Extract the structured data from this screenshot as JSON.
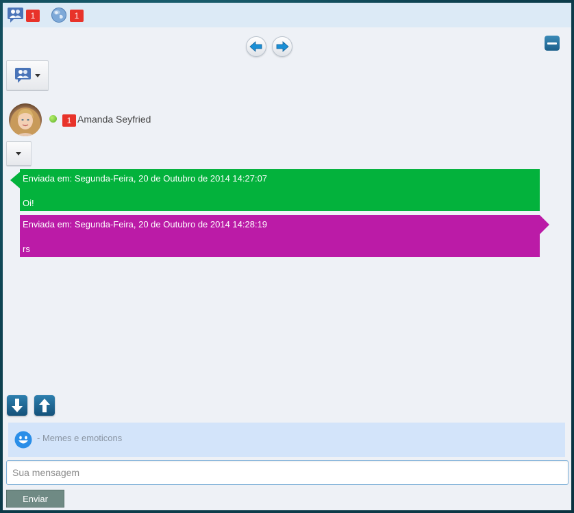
{
  "topbar": {
    "contacts_icon": "users-chat-icon",
    "contacts_count": "1",
    "global_icon": "globe-icon",
    "global_count": "1"
  },
  "navigation": {
    "prev_icon": "arrow-left-icon",
    "next_icon": "arrow-right-icon",
    "minimize_icon": "minimize-icon"
  },
  "contacts_menu": {
    "icon": "users-chat-icon",
    "caret": "caret-down-icon"
  },
  "contact": {
    "name": "Amanda Seyfried",
    "status": "online",
    "unread_count": "1"
  },
  "messages": [
    {
      "meta": "Enviada em: Segunda-Feira, 20 de Outubro de 2014 14:27:07",
      "text": "Oi!",
      "color": "#03b23c",
      "direction": "incoming"
    },
    {
      "meta": "Enviada em: Segunda-Feira, 20 de Outubro de 2014 14:28:19",
      "text": "rs",
      "color": "#bb1ba7",
      "direction": "outgoing"
    }
  ],
  "scroll": {
    "down_icon": "arrow-down-icon",
    "up_icon": "arrow-up-icon"
  },
  "emoticons": {
    "icon": "smiley-icon",
    "label": "- Memes e emoticons"
  },
  "composer": {
    "placeholder": "Sua mensagem",
    "value": "",
    "send_label": "Enviar"
  },
  "colors": {
    "accent": "#1b5f8a",
    "topbar": "#dceaf6",
    "badge": "#e8332a"
  }
}
